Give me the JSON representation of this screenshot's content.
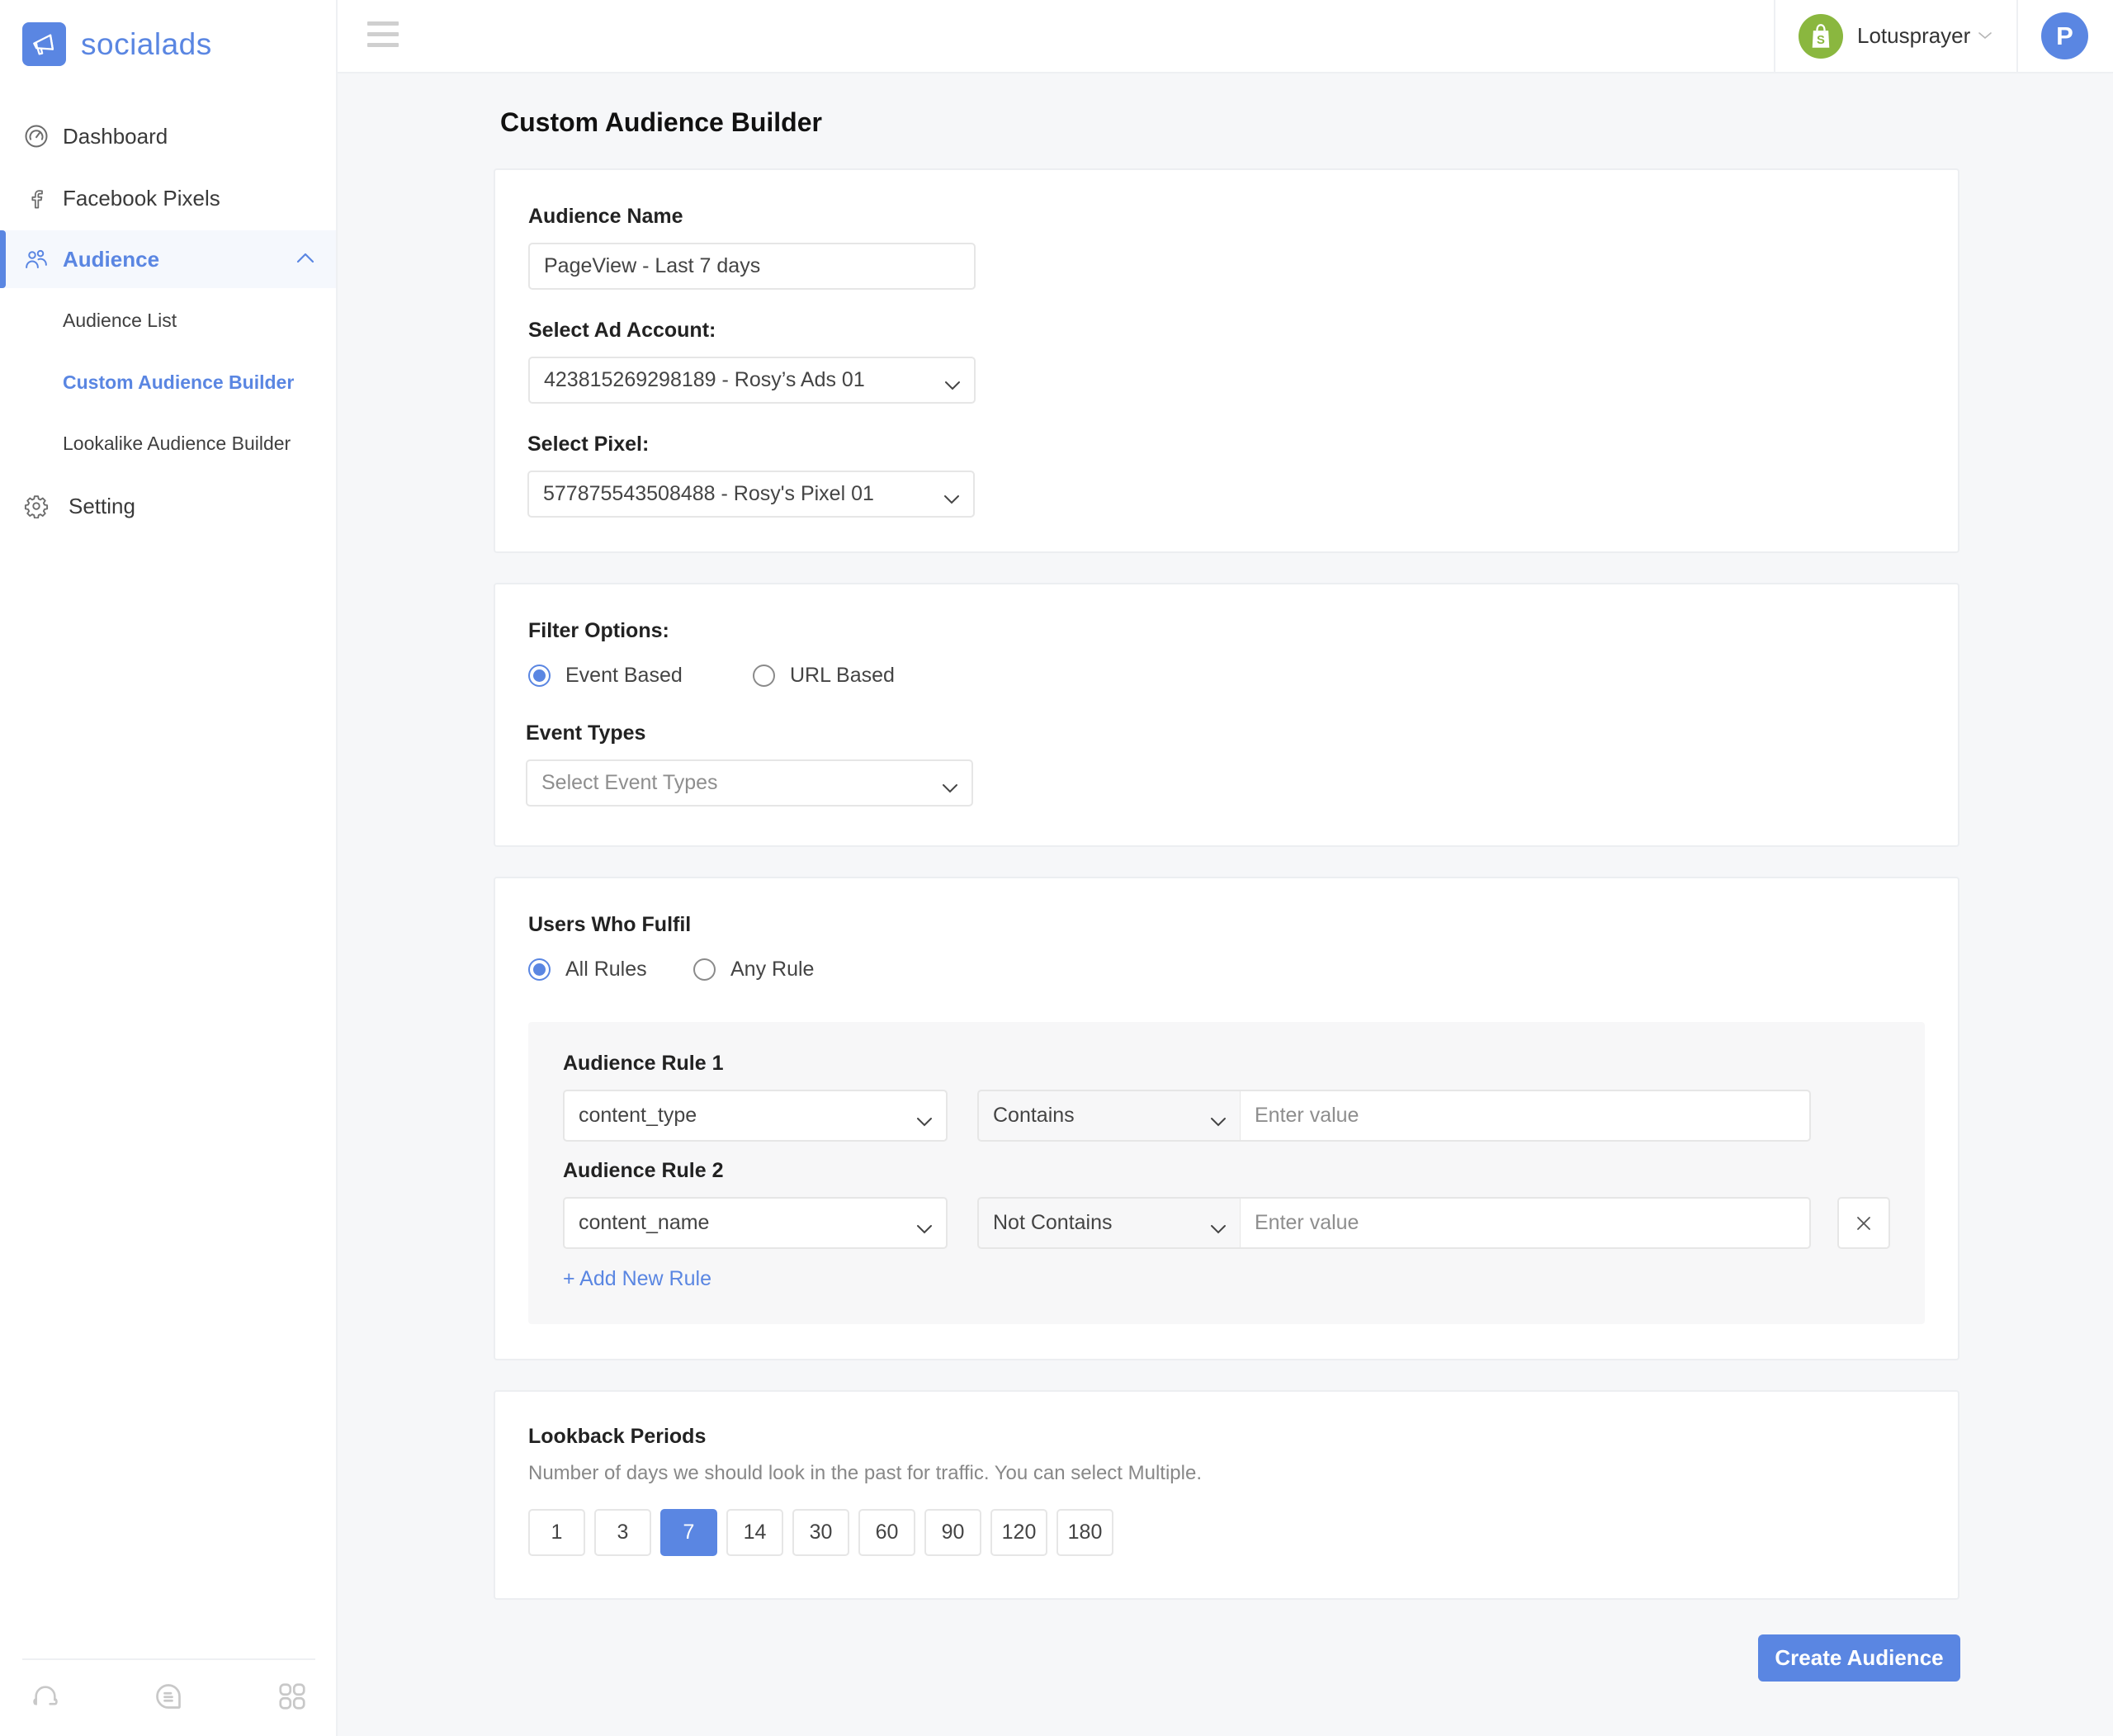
{
  "app": {
    "brand_name": "socialads"
  },
  "sidebar": {
    "items": [
      {
        "label": "Dashboard",
        "icon": "dashboard-gauge-icon"
      },
      {
        "label": "Facebook Pixels",
        "icon": "facebook-icon"
      },
      {
        "label": "Audience",
        "icon": "users-icon",
        "active": true,
        "expanded": true,
        "children": [
          {
            "label": "Audience List"
          },
          {
            "label": "Custom Audience Builder",
            "active": true
          },
          {
            "label": "Lookalike Audience Builder"
          }
        ]
      },
      {
        "label": "Setting",
        "icon": "gear-icon"
      }
    ],
    "footer_icons": [
      "headset-icon",
      "chat-icon",
      "apps-grid-icon"
    ]
  },
  "topbar": {
    "store_name": "Lotusprayer",
    "avatar_initial": "P"
  },
  "page": {
    "title": "Custom Audience Builder"
  },
  "basic": {
    "audience_name_label": "Audience Name",
    "audience_name_value": "PageView - Last 7 days",
    "ad_account_label": "Select Ad Account:",
    "ad_account_value": "423815269298189 - Rosy’s Ads 01",
    "pixel_label": "Select Pixel:",
    "pixel_value": "577875543508488 - Rosy's Pixel 01"
  },
  "filter": {
    "label": "Filter Options:",
    "options": [
      {
        "label": "Event Based",
        "checked": true
      },
      {
        "label": "URL Based",
        "checked": false
      }
    ],
    "event_types_label": "Event Types",
    "event_types_placeholder": "Select Event Types"
  },
  "fulfil": {
    "label": "Users Who Fulfil",
    "options": [
      {
        "label": "All Rules",
        "checked": true
      },
      {
        "label": "Any Rule",
        "checked": false
      }
    ],
    "rules": [
      {
        "title": "Audience Rule 1",
        "parameter": "content_type",
        "operator": "Contains",
        "value_placeholder": "Enter value",
        "removable": false
      },
      {
        "title": "Audience Rule 2",
        "parameter": "content_name",
        "operator": "Not Contains",
        "value_placeholder": "Enter value",
        "removable": true
      }
    ],
    "add_rule_label": "+ Add New Rule"
  },
  "lookback": {
    "label": "Lookback Periods",
    "description": "Number of days we should look in the past for traffic. You can select Multiple.",
    "periods": [
      "1",
      "3",
      "7",
      "14",
      "30",
      "60",
      "90",
      "120",
      "180"
    ],
    "selected": [
      "7"
    ]
  },
  "actions": {
    "create_label": "Create Audience"
  },
  "colors": {
    "accent": "#5a86e2",
    "store_badge": "#8ab73f",
    "background": "#f6f7f9"
  }
}
